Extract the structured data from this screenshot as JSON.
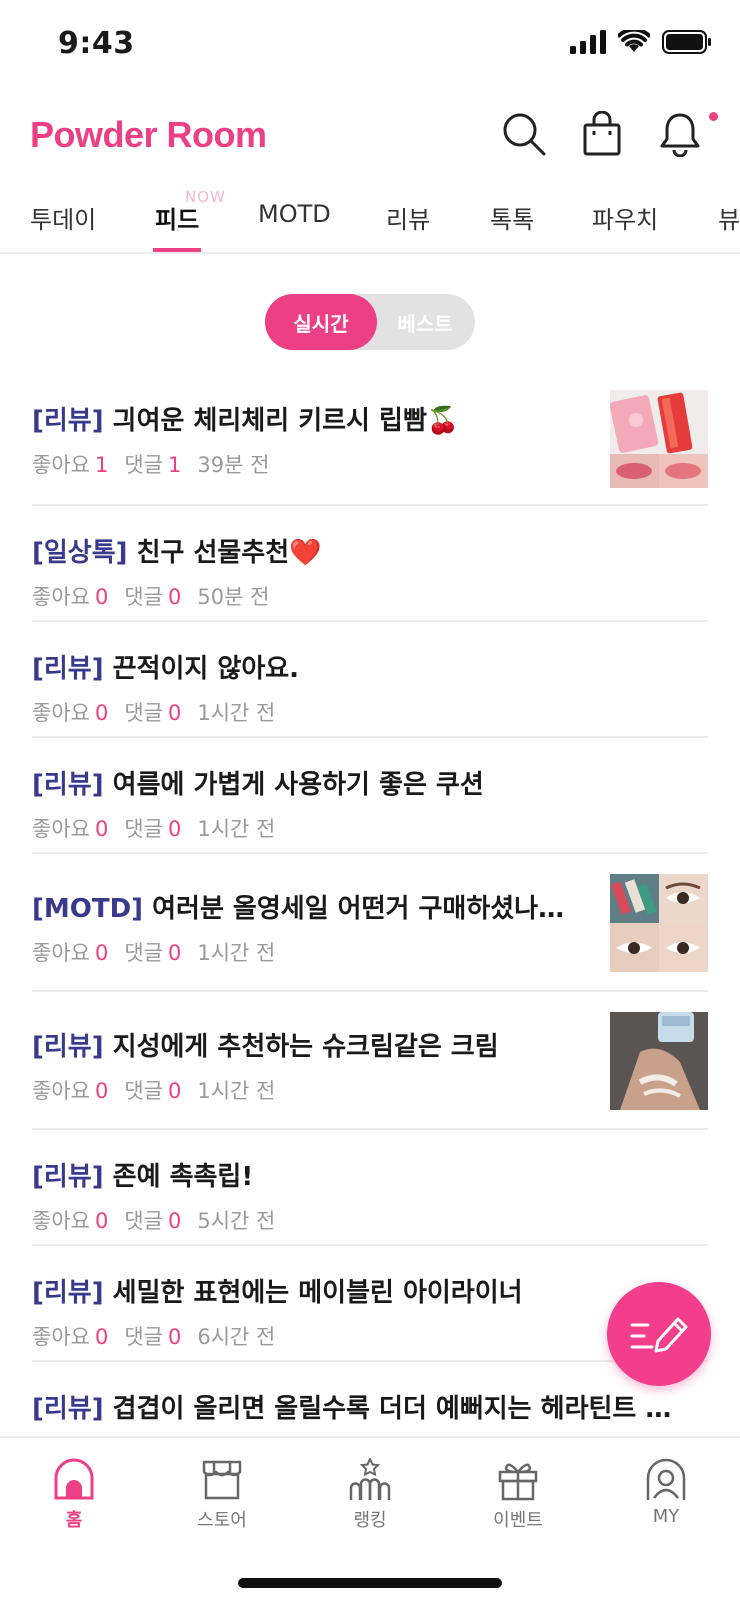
{
  "status_bar": {
    "time": "9:43"
  },
  "header": {
    "logo": "Powder Room"
  },
  "tabs": [
    {
      "label": "투데이"
    },
    {
      "label": "피드",
      "badge": "NOW",
      "active": true
    },
    {
      "label": "MOTD"
    },
    {
      "label": "리뷰"
    },
    {
      "label": "톡톡"
    },
    {
      "label": "파우치"
    },
    {
      "label": "뷰"
    }
  ],
  "toggle": {
    "on": "실시간",
    "off": "베스트"
  },
  "meta_labels": {
    "likes": "좋아요",
    "comments": "댓글"
  },
  "posts": [
    {
      "category": "[리뷰]",
      "title": "긔여운 체리체리 키르시 립빰🍒",
      "likes": "1",
      "comments": "1",
      "time": "39분 전",
      "thumb": "lip-product"
    },
    {
      "category": "[일상톡]",
      "title": "친구 선물추천❤️",
      "likes": "0",
      "comments": "0",
      "time": "50분 전"
    },
    {
      "category": "[리뷰]",
      "title": "끈적이지 않아요.",
      "likes": "0",
      "comments": "0",
      "time": "1시간 전"
    },
    {
      "category": "[리뷰]",
      "title": "여름에 가볍게 사용하기 좋은 쿠션",
      "likes": "0",
      "comments": "0",
      "time": "1시간 전"
    },
    {
      "category": "[MOTD]",
      "title": "여러분 올영세일 어떤거 구매하셨나…",
      "likes": "0",
      "comments": "0",
      "time": "1시간 전",
      "thumb": "eye-makeup"
    },
    {
      "category": "[리뷰]",
      "title": "지성에게 추천하는 슈크림같은 크림",
      "likes": "0",
      "comments": "0",
      "time": "1시간 전",
      "thumb": "cream-swatch"
    },
    {
      "category": "[리뷰]",
      "title": "존예 촉촉립!",
      "likes": "0",
      "comments": "0",
      "time": "5시간 전"
    },
    {
      "category": "[리뷰]",
      "title": "세밀한 표현에는 메이블린 아이라이너",
      "likes": "0",
      "comments": "0",
      "time": "6시간 전"
    },
    {
      "category": "[리뷰]",
      "title": "겹겹이 올리면 올릴수록 더더 예뻐지는 헤라틴트 …"
    }
  ],
  "bottom_nav": [
    {
      "label": "홈",
      "icon": "home-icon",
      "active": true
    },
    {
      "label": "스토어",
      "icon": "store-icon"
    },
    {
      "label": "랭킹",
      "icon": "ranking-icon"
    },
    {
      "label": "이벤트",
      "icon": "gift-icon"
    },
    {
      "label": "MY",
      "icon": "profile-icon"
    }
  ],
  "colors": {
    "brand": "#ec3f86",
    "category": "#3a3a8c",
    "meta": "#9a9a9a"
  }
}
